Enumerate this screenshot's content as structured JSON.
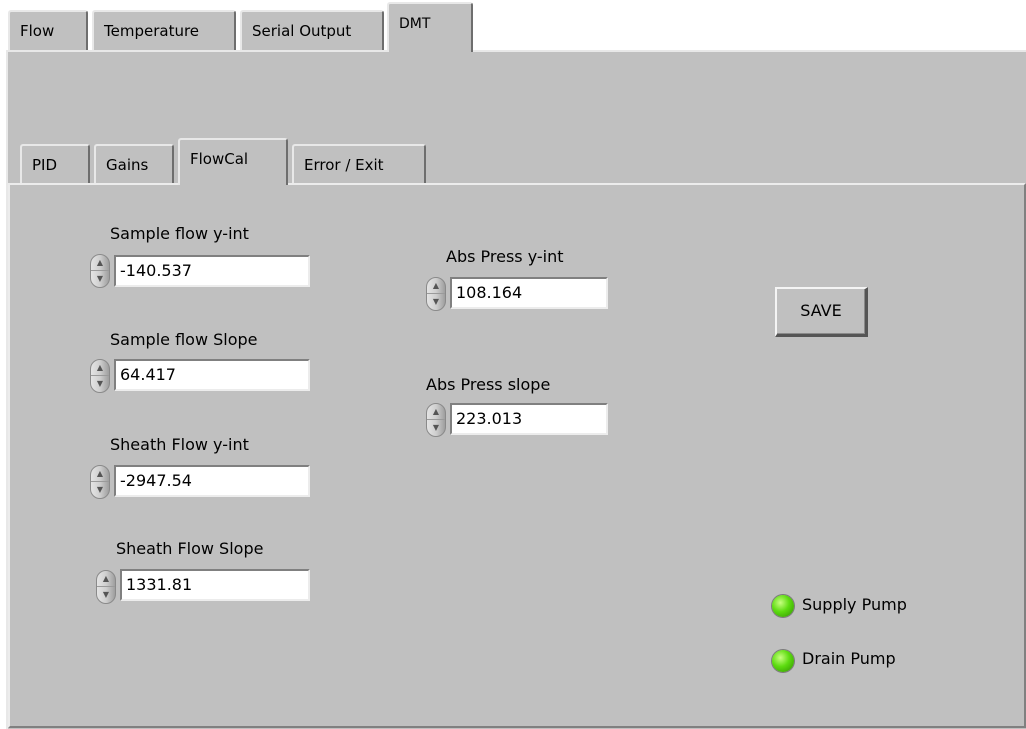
{
  "outer_tabs": [
    {
      "label": "Flow"
    },
    {
      "label": "Temperature"
    },
    {
      "label": "Serial Output"
    },
    {
      "label": "DMT",
      "selected": true
    }
  ],
  "inner_tabs": [
    {
      "label": "PID"
    },
    {
      "label": "Gains"
    },
    {
      "label": "FlowCal",
      "selected": true
    },
    {
      "label": "Error / Exit"
    }
  ],
  "controls": {
    "sample_flow_yint": {
      "label": "Sample flow y-int",
      "value": "-140.537"
    },
    "sample_flow_slope": {
      "label": "Sample flow Slope",
      "value": "64.417"
    },
    "sheath_flow_yint": {
      "label": "Sheath Flow y-int",
      "value": "-2947.54"
    },
    "sheath_flow_slope": {
      "label": "Sheath Flow Slope",
      "value": "1331.81"
    },
    "abs_press_yint": {
      "label": "Abs Press y-int",
      "value": "108.164"
    },
    "abs_press_slope": {
      "label": "Abs Press slope",
      "value": "223.013"
    }
  },
  "save_button": {
    "label": "SAVE"
  },
  "indicators": [
    {
      "label": "Supply Pump",
      "state": "on",
      "color": "#5ddc10"
    },
    {
      "label": "Drain Pump",
      "state": "on",
      "color": "#5ddc10"
    }
  ],
  "colors": {
    "panel": "#c0c0c0",
    "field": "#ffffff"
  }
}
